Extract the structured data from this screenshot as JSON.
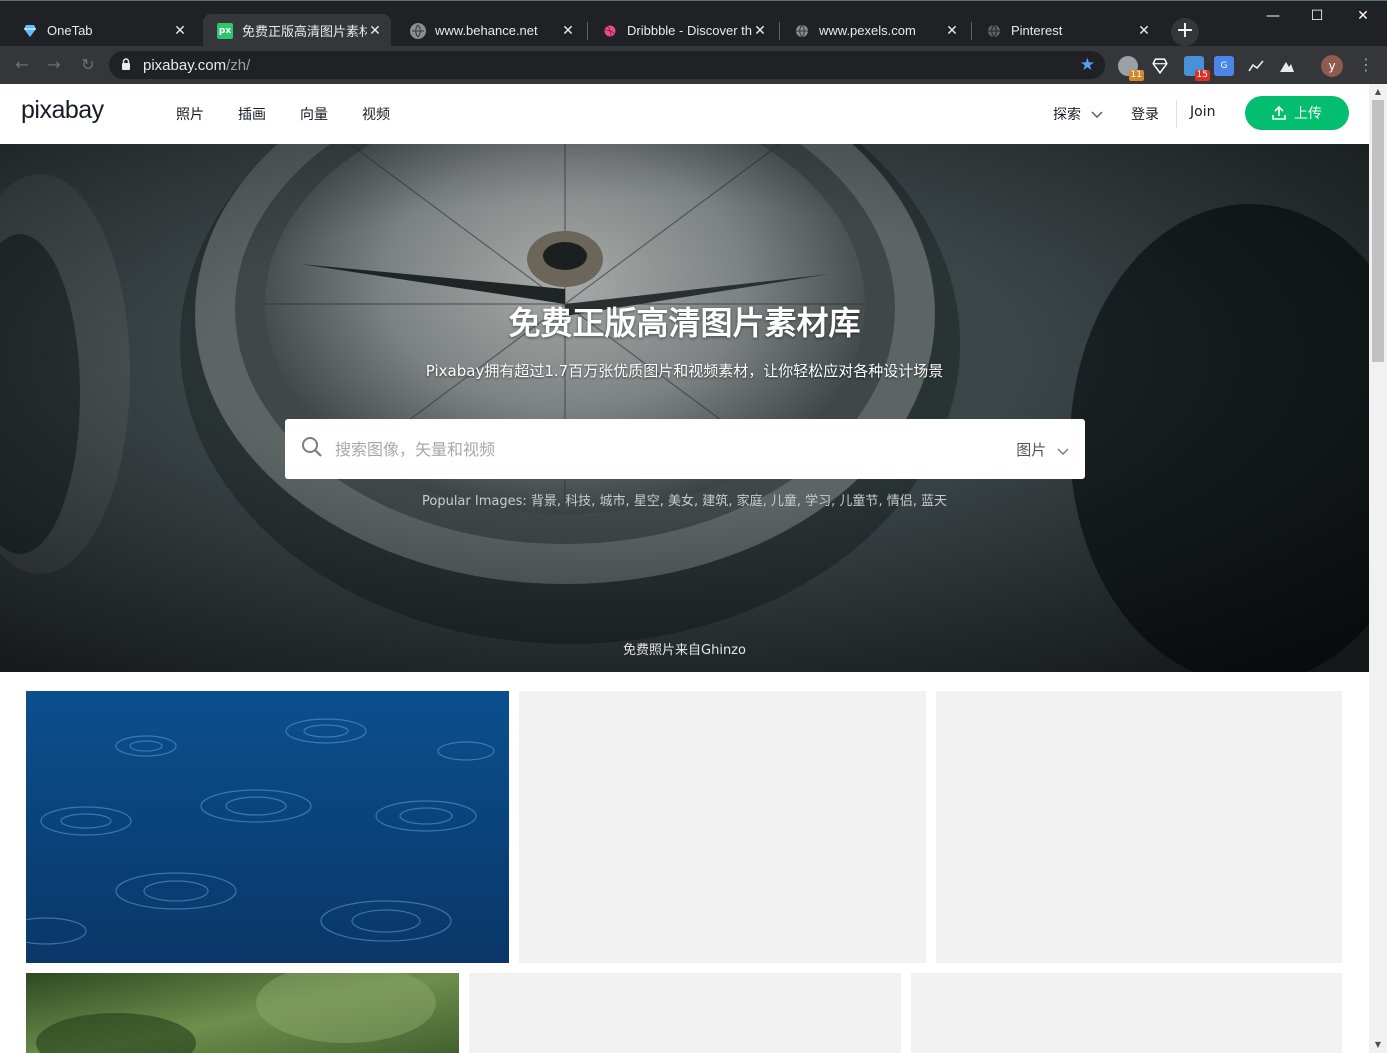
{
  "browser": {
    "tabs": [
      {
        "title": "OneTab",
        "icon": "diamond-icon"
      },
      {
        "title": "免费正版高清图片素材库",
        "icon": "pixabay-favicon"
      },
      {
        "title": "www.behance.net",
        "icon": "globe-icon"
      },
      {
        "title": "Dribbble - Discover the",
        "icon": "dribbble-favicon"
      },
      {
        "title": "www.pexels.com",
        "icon": "globe-icon"
      },
      {
        "title": "Pinterest",
        "icon": "globe-icon"
      }
    ],
    "active_tab": 1,
    "url": {
      "host": "pixabay.com",
      "path": "/zh/"
    },
    "extension_badges": {
      "first": "11",
      "second": "15"
    },
    "profile_initial": "y"
  },
  "header": {
    "logo": "pixabay",
    "nav": [
      "照片",
      "插画",
      "向量",
      "视频"
    ],
    "explore": "探索",
    "login": "登录",
    "join": "Join",
    "upload": "上传"
  },
  "hero": {
    "title": "免费正版高清图片素材库",
    "subtitle": "Pixabay拥有超过1.7百万张优质图片和视频素材，让你轻松应对各种设计场景",
    "search_placeholder": "搜索图像，矢量和视频",
    "search_type": "图片",
    "popular_label": "Popular Images:",
    "popular_tags": [
      "背景",
      "科技",
      "城市",
      "星空",
      "美女",
      "建筑",
      "家庭",
      "儿童",
      "学习",
      "儿童节",
      "情侣",
      "蓝天"
    ],
    "credit": "免费照片来自Ghinzo"
  },
  "colors": {
    "brand_green": "#02be6e",
    "chrome_dark": "#202124",
    "chrome_toolbar": "#35363a",
    "placeholder_tile": "#f2f2f2"
  }
}
